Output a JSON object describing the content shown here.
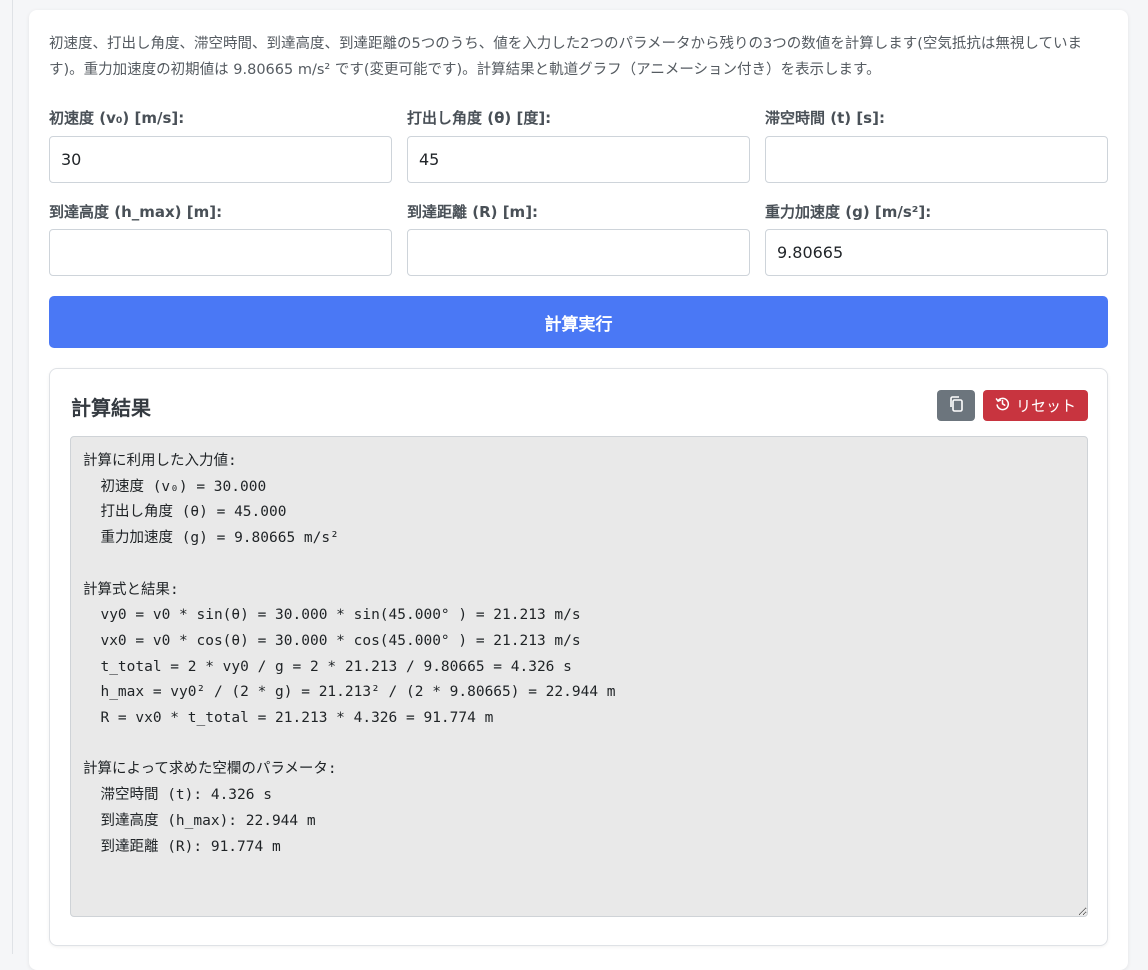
{
  "description": "初速度、打出し角度、滞空時間、到達高度、到達距離の5つのうち、値を入力した2つのパラメータから残りの3つの数値を計算します(空気抵抗は無視しています)。重力加速度の初期値は 9.80665 m/s² です(変更可能です)。計算結果と軌道グラフ（アニメーション付き）を表示します。",
  "fields": {
    "v0": {
      "label": "初速度 (v₀) [m/s]:",
      "value": "30"
    },
    "theta": {
      "label": "打出し角度 (θ) [度]:",
      "value": "45"
    },
    "t": {
      "label": "滞空時間 (t) [s]:",
      "value": ""
    },
    "hmax": {
      "label": "到達高度 (h_max) [m]:",
      "value": ""
    },
    "range": {
      "label": "到達距離 (R) [m]:",
      "value": ""
    },
    "g": {
      "label": "重力加速度 (g) [m/s²]:",
      "value": "9.80665"
    }
  },
  "calc_button": "計算実行",
  "result": {
    "title": "計算結果",
    "copy_icon": "copy-icon",
    "reset_icon": "history-icon",
    "reset_label": "リセット",
    "text": "計算に利用した入力値:\n  初速度 (v₀) = 30.000\n  打出し角度 (θ) = 45.000\n  重力加速度 (g) = 9.80665 m/s²\n\n計算式と結果:\n  vy0 = v0 * sin(θ) = 30.000 * sin(45.000° ) = 21.213 m/s\n  vx0 = v0 * cos(θ) = 30.000 * cos(45.000° ) = 21.213 m/s\n  t_total = 2 * vy0 / g = 2 * 21.213 / 9.80665 = 4.326 s\n  h_max = vy0² / (2 * g) = 21.213² / (2 * 9.80665) = 22.944 m\n  R = vx0 * t_total = 21.213 * 4.326 = 91.774 m\n\n計算によって求めた空欄のパラメータ:\n  滞空時間 (t): 4.326 s\n  到達高度 (h_max): 22.944 m\n  到達距離 (R): 91.774 m"
  },
  "colors": {
    "primary": "#4a78f5",
    "secondary": "#6c757d",
    "danger": "#c8343f",
    "result_bg": "#e9e9e9"
  }
}
